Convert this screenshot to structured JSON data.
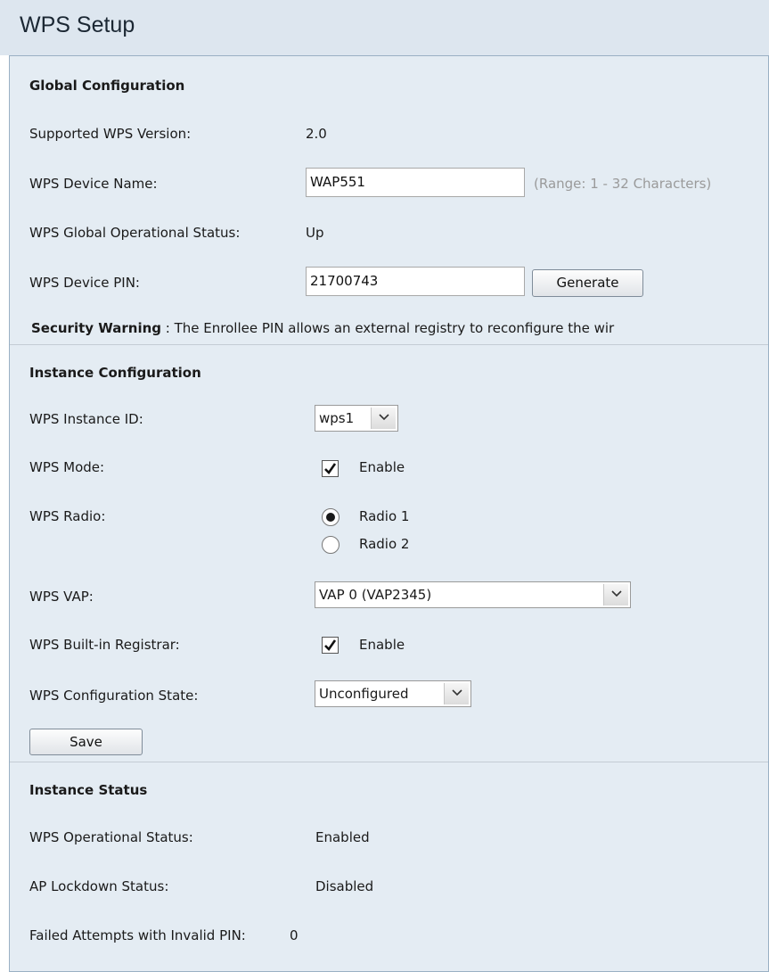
{
  "header": {
    "title": "WPS Setup"
  },
  "global": {
    "section_title": "Global Configuration",
    "supported_version_label": "Supported WPS Version:",
    "supported_version_value": "2.0",
    "device_name_label": "WPS Device Name:",
    "device_name_value": "WAP551",
    "device_name_hint": "(Range: 1 - 32 Characters)",
    "global_status_label": "WPS Global Operational Status:",
    "global_status_value": "Up",
    "device_pin_label": "WPS Device PIN:",
    "device_pin_value": "21700743",
    "generate_label": "Generate",
    "warning_bold": "Security Warning",
    "warning_text": " : The Enrollee PIN allows an external registry to reconfigure the wir"
  },
  "instance": {
    "section_title": "Instance Configuration",
    "instance_id_label": "WPS Instance ID:",
    "instance_id_value": "wps1",
    "mode_label": "WPS Mode:",
    "mode_checked": true,
    "mode_option": "Enable",
    "radio_label": "WPS Radio:",
    "radio_options": [
      "Radio 1",
      "Radio 2"
    ],
    "radio_selected": "Radio 1",
    "vap_label": "WPS VAP:",
    "vap_value": "VAP 0 (VAP2345)",
    "registrar_label": "WPS Built-in Registrar:",
    "registrar_checked": true,
    "registrar_option": "Enable",
    "config_state_label": "WPS Configuration State:",
    "config_state_value": "Unconfigured",
    "save_label": "Save"
  },
  "status": {
    "section_title": "Instance Status",
    "operational_label": "WPS Operational Status:",
    "operational_value": "Enabled",
    "lockdown_label": "AP Lockdown Status:",
    "lockdown_value": "Disabled",
    "failed_label": "Failed Attempts with Invalid PIN:",
    "failed_value": "0"
  }
}
